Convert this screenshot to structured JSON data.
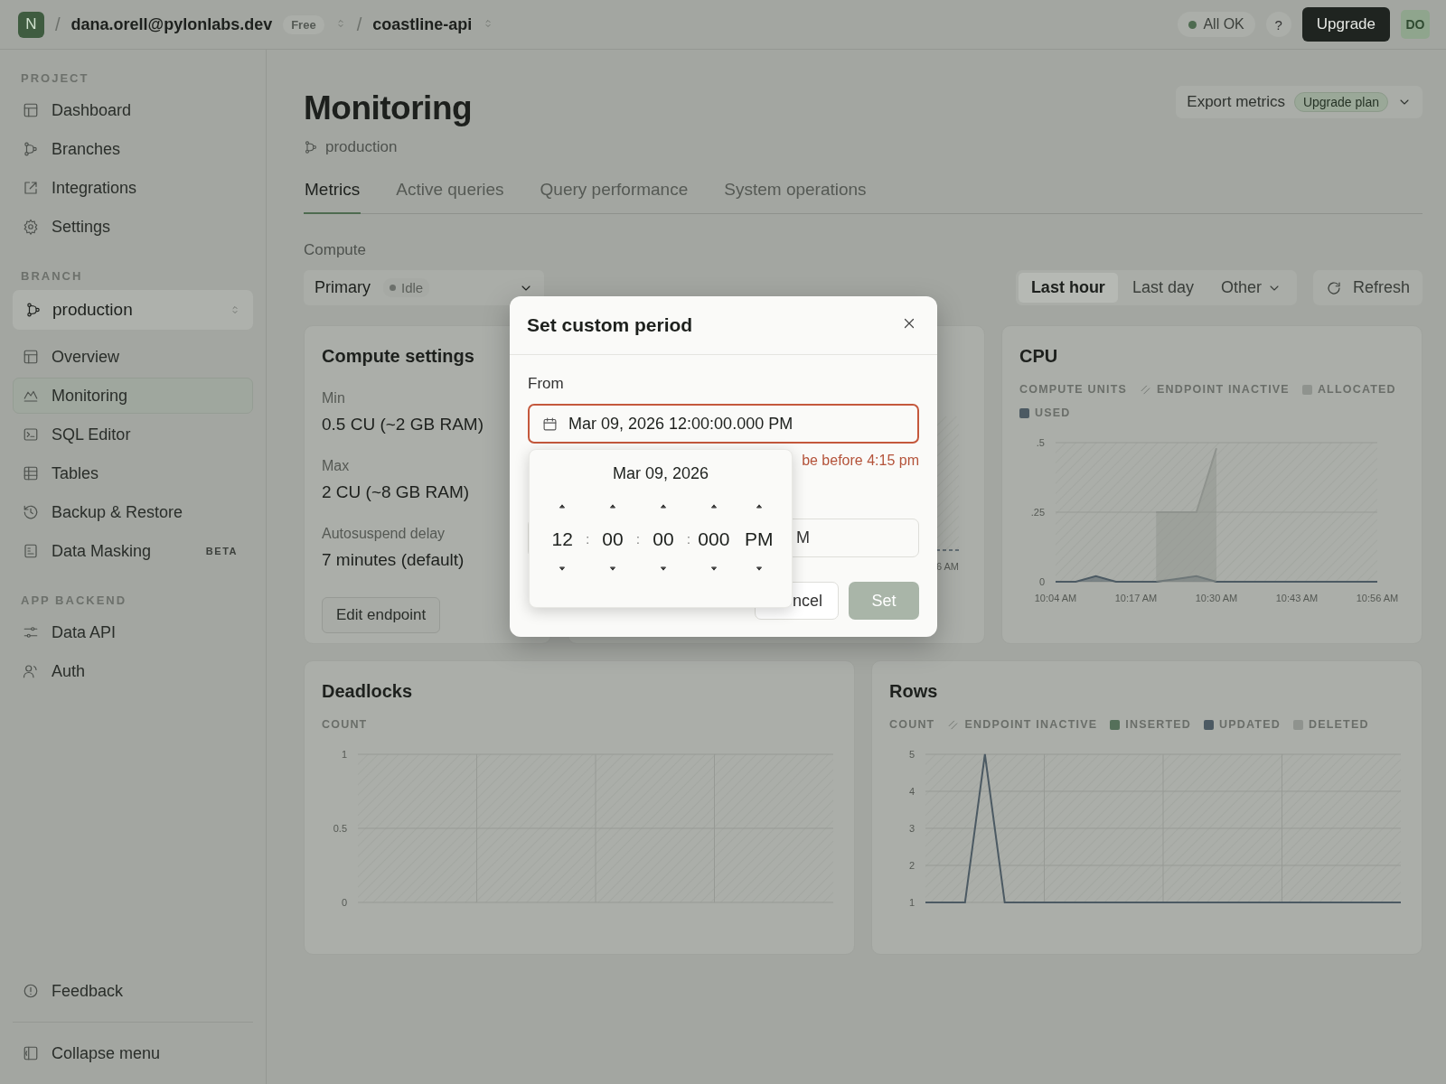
{
  "top_bar": {
    "logo": "N",
    "separator": "/",
    "account": "dana.orell@pylonlabs.dev",
    "plan_badge": "Free",
    "project": "coastline-api",
    "status": "All OK",
    "help": "?",
    "upgrade": "Upgrade",
    "avatar": "DO"
  },
  "sidebar": {
    "sections": [
      {
        "heading": "PROJECT",
        "items": [
          {
            "label": "Dashboard",
            "selected": false
          },
          {
            "label": "Branches",
            "selected": false
          },
          {
            "label": "Integrations",
            "selected": false
          },
          {
            "label": "Settings",
            "selected": false
          }
        ]
      },
      {
        "heading": "BRANCH",
        "branch_select": "production",
        "items": [
          {
            "label": "Overview",
            "selected": false
          },
          {
            "label": "Monitoring",
            "selected": true
          },
          {
            "label": "SQL Editor",
            "selected": false
          },
          {
            "label": "Tables",
            "selected": false
          },
          {
            "label": "Backup & Restore",
            "selected": false
          },
          {
            "label": "Data Masking",
            "selected": false,
            "badge": "BETA"
          }
        ]
      },
      {
        "heading": "APP BACKEND",
        "items": [
          {
            "label": "Data API",
            "selected": false
          },
          {
            "label": "Auth",
            "selected": false
          }
        ]
      }
    ],
    "footer": [
      {
        "label": "Feedback"
      },
      {
        "label": "Collapse menu"
      }
    ]
  },
  "page": {
    "title": "Monitoring",
    "branch": "production",
    "export": {
      "label": "Export metrics",
      "badge": "Upgrade plan"
    },
    "tabs": [
      {
        "label": "Metrics",
        "selected": true
      },
      {
        "label": "Active queries",
        "selected": false
      },
      {
        "label": "Query performance",
        "selected": false
      },
      {
        "label": "System operations",
        "selected": false
      }
    ],
    "compute": {
      "label": "Compute",
      "select": "Primary",
      "status": "Idle"
    },
    "ranges": [
      {
        "label": "Last hour",
        "selected": true
      },
      {
        "label": "Last day",
        "selected": false
      },
      {
        "label": "Other",
        "selected": false
      }
    ],
    "refresh": "Refresh"
  },
  "compute_settings": {
    "title": "Compute settings",
    "fields": [
      {
        "label": "Min",
        "value": "0.5 CU (~2 GB RAM)"
      },
      {
        "label": "Max",
        "value": "2 CU (~8 GB RAM)"
      },
      {
        "label": "Autosuspend delay",
        "value": "7 minutes (default)"
      }
    ],
    "button": "Edit endpoint"
  },
  "hidden_card": {
    "tick_label": "6 AM"
  },
  "cpu": {
    "title": "CPU",
    "legend": [
      {
        "label": "ENDPOINT INACTIVE",
        "kind": "hatch"
      }
    ],
    "chart_data": {
      "type": "area",
      "ylabel": "COMPUTE UNITS",
      "grid": true,
      "categories": [
        "10:04 AM",
        null,
        null,
        null,
        "10:17 AM",
        null,
        null,
        null,
        "10:30 AM",
        null,
        null,
        null,
        "10:43 AM",
        null,
        null,
        null,
        "10:56 AM"
      ],
      "ylim": [
        0,
        0.5
      ],
      "yticks": [
        {
          "value": 0,
          "label": "0"
        },
        {
          "value": 0.25,
          "label": ".25"
        },
        {
          "value": 0.5,
          "label": ".5"
        }
      ],
      "series": [
        {
          "name": "ALLOCATED",
          "color": "#8f938e",
          "values": [
            null,
            null,
            null,
            null,
            null,
            0.25,
            0.25,
            0.25,
            0.48,
            null,
            null,
            null,
            null,
            null,
            null,
            null,
            null
          ]
        },
        {
          "name": "USED",
          "color": "#4c5a63",
          "values": [
            0,
            0,
            0.02,
            0,
            0,
            0,
            0.01,
            0.02,
            0,
            0,
            0,
            0,
            0,
            0,
            0,
            0,
            0
          ]
        }
      ]
    }
  },
  "deadlocks": {
    "title": "Deadlocks",
    "unit_label": "COUNT",
    "y_labels": [
      "1",
      "0.5",
      "0"
    ]
  },
  "rows": {
    "title": "Rows",
    "legend": [
      {
        "label": "ENDPOINT INACTIVE",
        "kind": "hatch"
      }
    ],
    "chart_data": {
      "type": "line",
      "ylabel": "COUNT",
      "grid": true,
      "categories": [
        null,
        null,
        null,
        null,
        null,
        null,
        null,
        null,
        null,
        null,
        null,
        null,
        null,
        null,
        null,
        null,
        null,
        null,
        null,
        null,
        null,
        null,
        null,
        null,
        null
      ],
      "ylim": [
        1,
        5
      ],
      "yticks": [
        1,
        2,
        3,
        4,
        5
      ],
      "series": [
        {
          "name": "INSERTED",
          "color": "#55705a",
          "values": [
            null,
            null,
            null,
            null,
            null,
            null,
            null,
            null,
            null,
            null,
            null,
            null,
            null,
            null,
            null,
            null,
            null,
            null,
            null,
            null,
            null,
            null,
            null,
            null,
            null
          ]
        },
        {
          "name": "UPDATED",
          "color": "#4c5a63",
          "values": [
            1,
            1,
            1,
            5,
            1,
            1,
            1,
            1,
            1,
            1,
            1,
            1,
            1,
            1,
            1,
            1,
            1,
            1,
            1,
            1,
            1,
            1,
            1,
            1,
            1
          ]
        },
        {
          "name": "DELETED",
          "color": "#8f938e",
          "values": [
            null,
            null,
            null,
            null,
            null,
            null,
            null,
            null,
            null,
            null,
            null,
            null,
            null,
            null,
            null,
            null,
            null,
            null,
            null,
            null,
            null,
            null,
            null,
            null,
            null
          ]
        }
      ]
    }
  },
  "dialog": {
    "title": "Set custom period",
    "from_label": "From",
    "from_value": "Mar 09, 2026 12:00:00.000 PM",
    "invalid": true,
    "error": "be before 4:15 pm",
    "to_value": "M",
    "cancel": "ncel",
    "set": "Set",
    "set_disabled": true,
    "picker": {
      "date": "Mar 09, 2026",
      "separator": ":",
      "columns": [
        {
          "value": "12",
          "kind": "number"
        },
        {
          "value": "00",
          "kind": "number"
        },
        {
          "value": "00",
          "kind": "number"
        },
        {
          "value": "000",
          "kind": "number"
        },
        {
          "value": "PM",
          "kind": "period"
        }
      ]
    }
  }
}
